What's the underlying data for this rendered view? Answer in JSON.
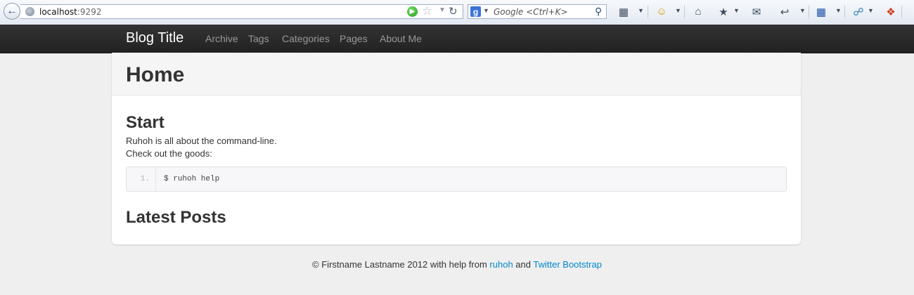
{
  "browser": {
    "url_host": "localhost",
    "url_port": ":9292",
    "search_placeholder": "Google <Ctrl+K>",
    "icons": [
      "back-arrow-icon",
      "globe-icon",
      "go-icon",
      "star-icon",
      "reload-icon",
      "google-icon",
      "search-icon",
      "screenshot-icon",
      "smiley-icon",
      "home-icon",
      "bookmark-icon",
      "mail-icon",
      "reply-icon",
      "apps-icon",
      "share-icon",
      "addon-icon"
    ]
  },
  "navbar": {
    "brand": "Blog Title",
    "items": [
      "Archive",
      "Tags",
      "Categories",
      "Pages",
      "About Me"
    ]
  },
  "page": {
    "title": "Home",
    "start_heading": "Start",
    "line1": "Ruhoh is all about the command-line.",
    "line2": "Check out the goods:",
    "code": {
      "line_number": "1.",
      "text": "$ ruhoh help"
    },
    "latest_heading": "Latest Posts"
  },
  "footer": {
    "prefix": "© Firstname Lastname 2012 with help from",
    "link1": "ruhoh",
    "middle": "and",
    "link2": "Twitter Bootstrap"
  },
  "colors": {
    "navbar_bg": "#222222",
    "link": "#0088cc",
    "page_bg": "#efefef"
  }
}
